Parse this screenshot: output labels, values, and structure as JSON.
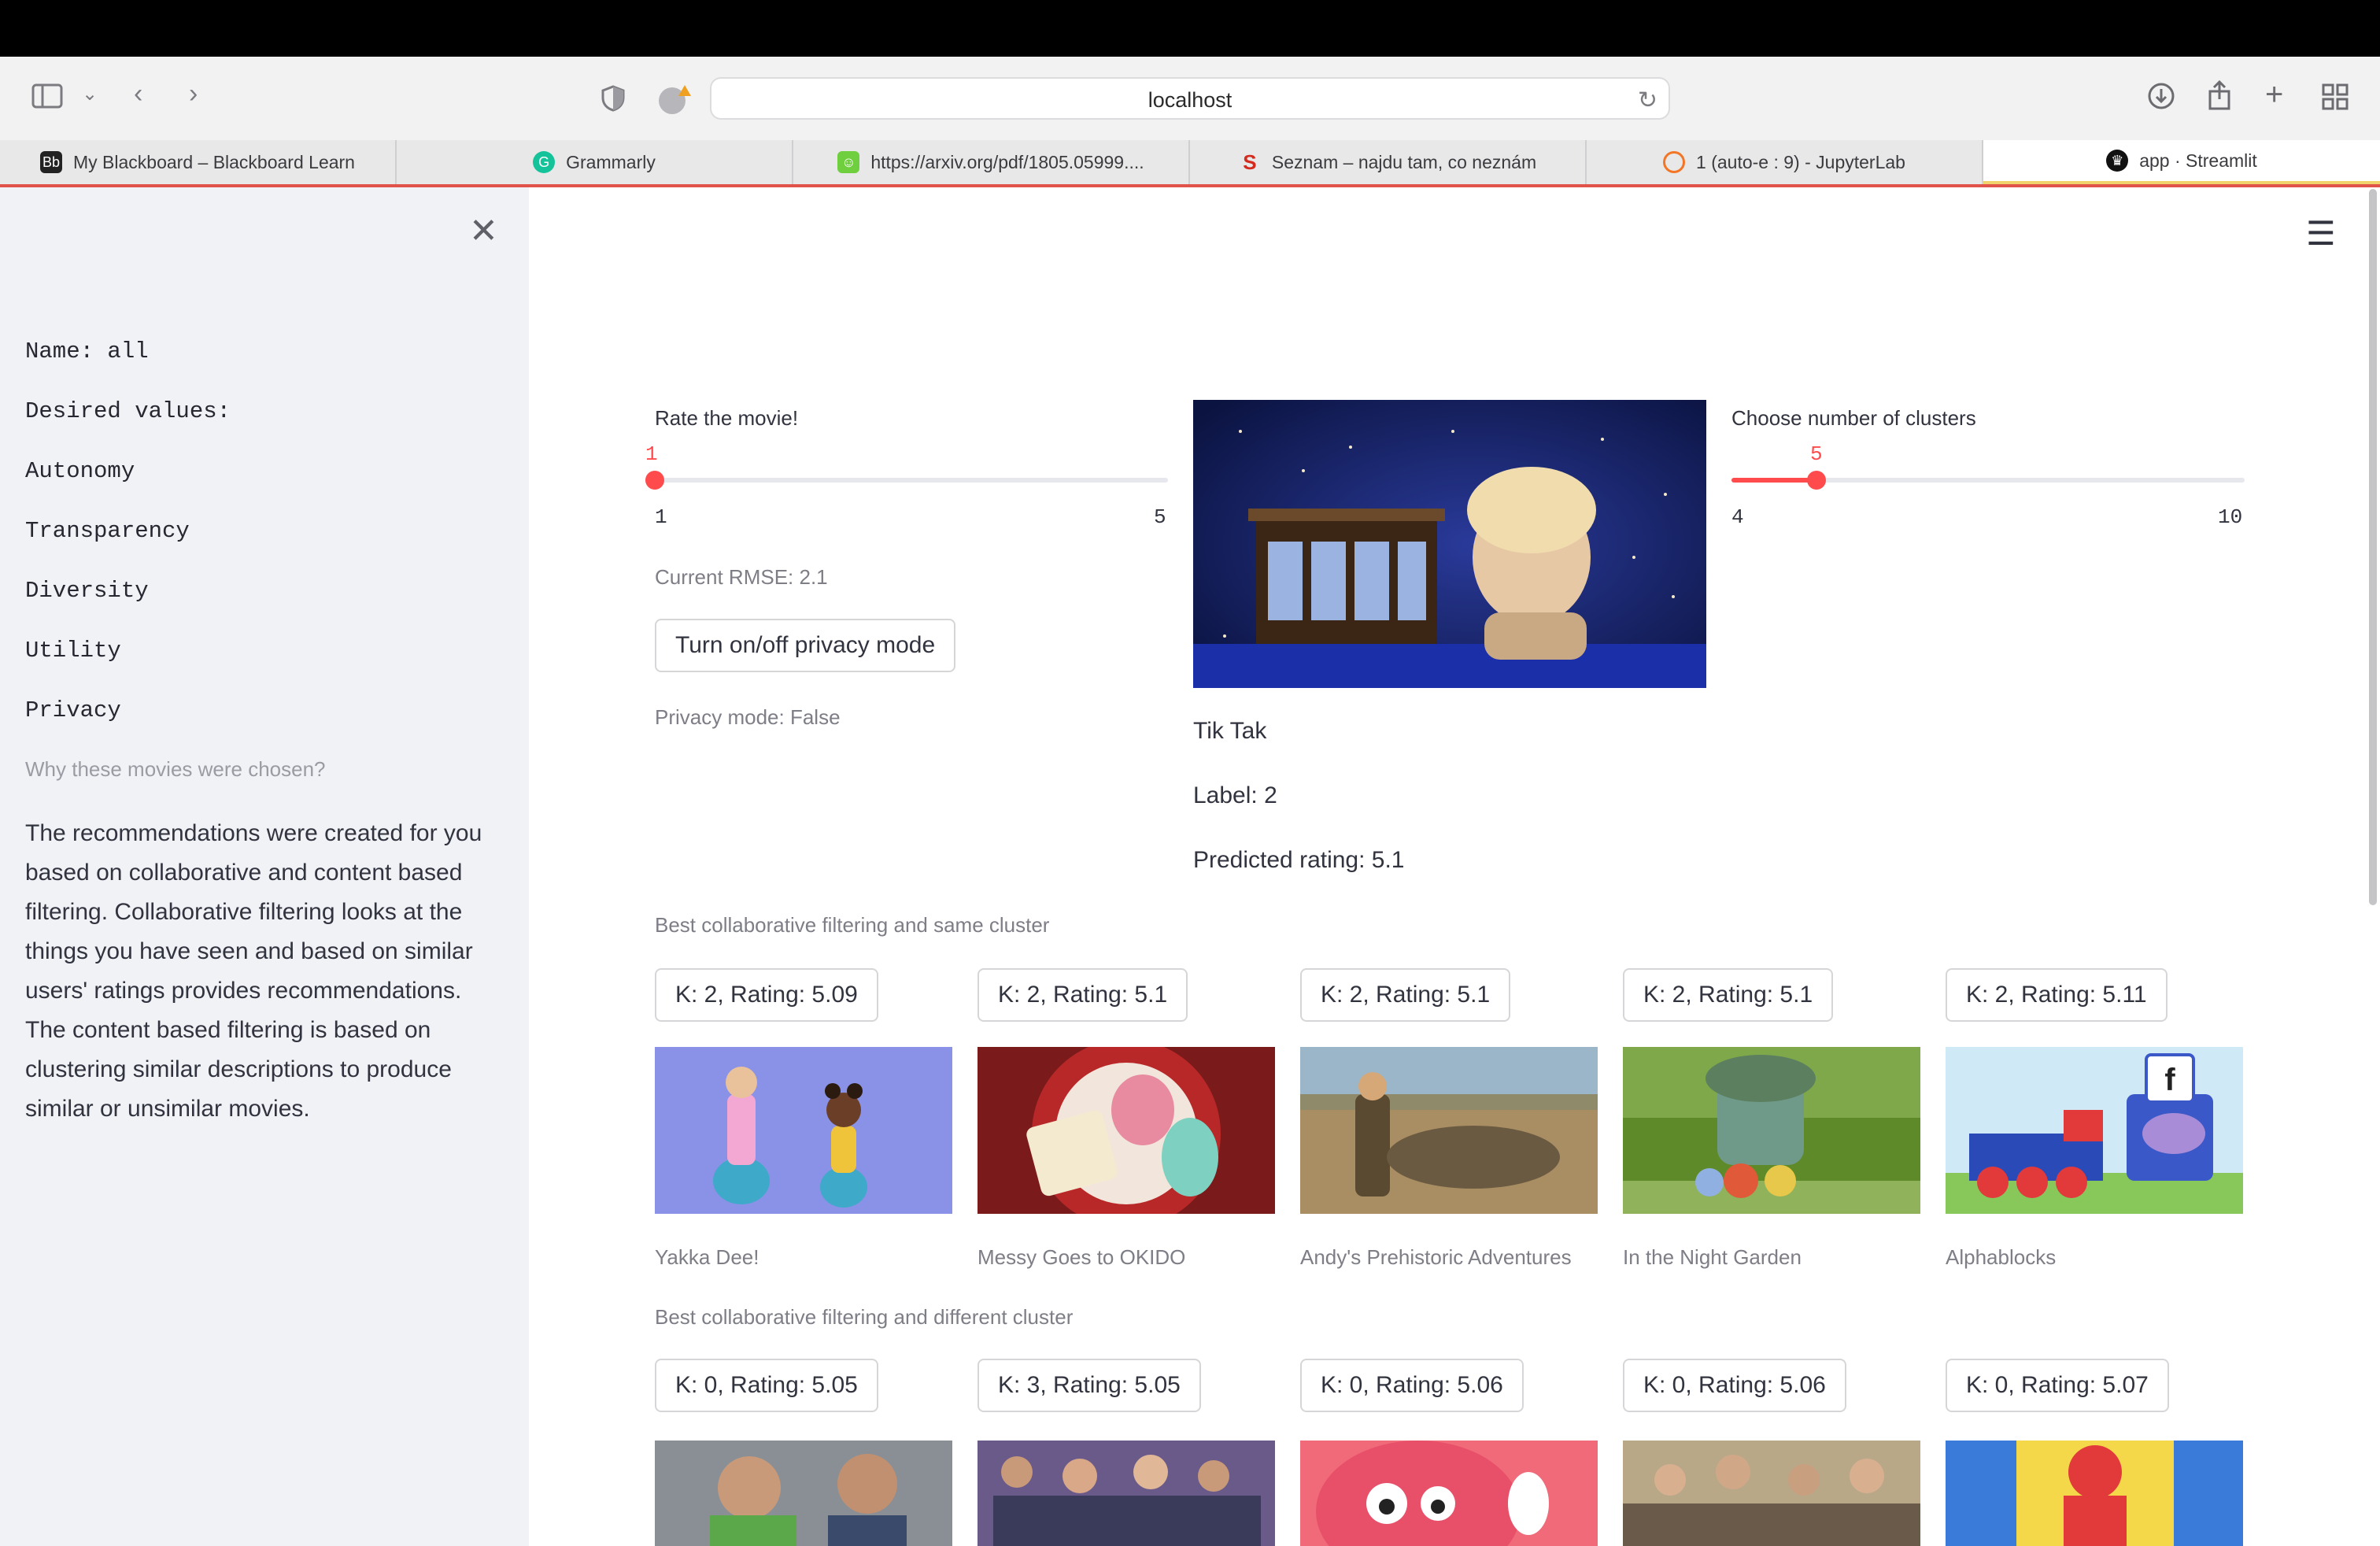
{
  "browser": {
    "url": "localhost",
    "tabs": [
      {
        "label": "My Blackboard – Blackboard Learn",
        "icon": "blackboard-icon"
      },
      {
        "label": "Grammarly",
        "icon": "grammarly-icon"
      },
      {
        "label": "https://arxiv.org/pdf/1805.05999....",
        "icon": "arxiv-icon"
      },
      {
        "label": "Seznam – najdu tam, co neznám",
        "icon": "seznam-icon"
      },
      {
        "label": "1 (auto-e : 9) - JupyterLab",
        "icon": "jupyter-icon"
      },
      {
        "label": "app · Streamlit",
        "icon": "streamlit-icon"
      }
    ]
  },
  "sidebar": {
    "lines": [
      "Name: all",
      "Desired values:",
      "Autonomy",
      "Transparency",
      "Diversity",
      "Utility",
      "Privacy"
    ],
    "caption": "Why these movies were chosen?",
    "explanation": "The recommendations were created for you based on collaborative and content based filtering. Collaborative filtering looks at the things you have seen and based on similar users' ratings provides recommendations. The content based filtering is based on clustering similar descriptions to produce similar or unsimilar movies."
  },
  "rating": {
    "label": "Rate the movie!",
    "value": 1,
    "min": 1,
    "max": 5,
    "rmse_text": "Current RMSE: 2.1",
    "privacy_button": "Turn on/off privacy mode",
    "privacy_status": "Privacy mode: False"
  },
  "clusters": {
    "label": "Choose number of clusters",
    "value": 5,
    "min": 4,
    "max": 10
  },
  "current_movie": {
    "title": "Tik Tak",
    "label_text": "Label: 2",
    "predicted_text": "Predicted rating: 5.1"
  },
  "section_same": {
    "heading": "Best collaborative filtering and same cluster",
    "items": [
      {
        "button": "K: 2, Rating: 5.09",
        "title": "Yakka Dee!"
      },
      {
        "button": "K: 2, Rating: 5.1",
        "title": "Messy Goes to OKIDO"
      },
      {
        "button": "K: 2, Rating: 5.1",
        "title": "Andy's Prehistoric Adventures"
      },
      {
        "button": "K: 2, Rating: 5.1",
        "title": "In the Night Garden"
      },
      {
        "button": "K: 2, Rating: 5.11",
        "title": "Alphablocks"
      }
    ]
  },
  "section_diff": {
    "heading": "Best collaborative filtering and different cluster",
    "items": [
      {
        "button": "K: 0, Rating: 5.05"
      },
      {
        "button": "K: 3, Rating: 5.05"
      },
      {
        "button": "K: 0, Rating: 5.06"
      },
      {
        "button": "K: 0, Rating: 5.06"
      },
      {
        "button": "K: 0, Rating: 5.07"
      }
    ]
  }
}
